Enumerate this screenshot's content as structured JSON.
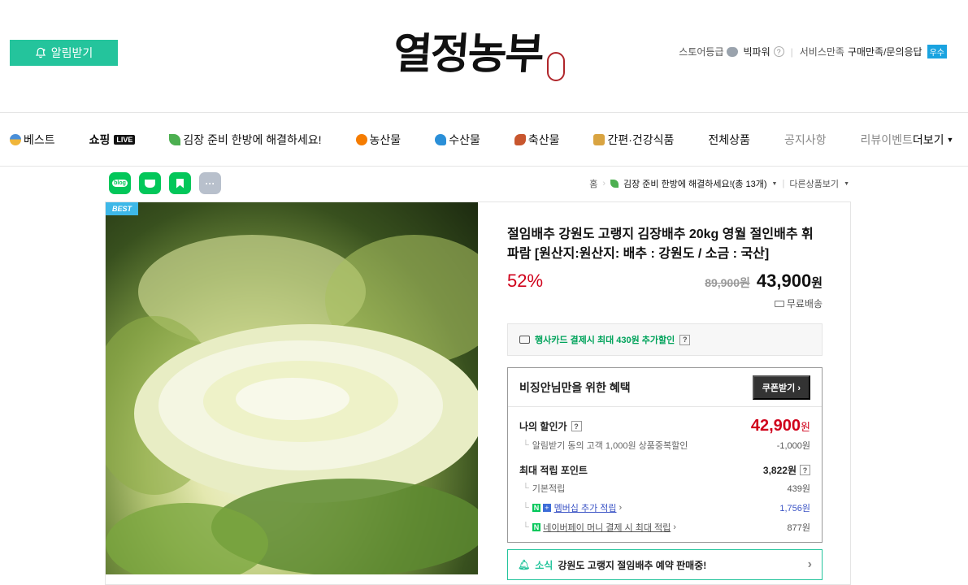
{
  "header": {
    "alarm_button": "알림받기",
    "logo_text": "열정농부",
    "store_grade_label": "스토어등급",
    "store_grade_value": "빅파워",
    "service_label": "서비스만족",
    "service_value": "구매만족/문의응답",
    "service_badge": "우수"
  },
  "nav": {
    "items": [
      {
        "label": "베스트",
        "icon": "medal-icon"
      },
      {
        "label": "쇼핑",
        "badge": "LIVE"
      },
      {
        "label": "김장 준비 한방에 해결하세요!",
        "icon": "leaf-icon"
      },
      {
        "label": "농산물",
        "icon": "orange-icon"
      },
      {
        "label": "수산물",
        "icon": "wave-icon"
      },
      {
        "label": "축산물",
        "icon": "meat-icon"
      },
      {
        "label": "간편·건강식품",
        "icon": "food-icon"
      },
      {
        "label": "전체상품"
      },
      {
        "label": "공지사항"
      },
      {
        "label": "리뷰이벤트"
      }
    ],
    "more": "더보기"
  },
  "share": {
    "blog": "blog",
    "cafe_icon": "cup-icon",
    "bookmark_icon": "bookmark-icon",
    "more": "···"
  },
  "breadcrumb": {
    "home": "홈",
    "category": "김장 준비 한방에 해결하세요!(총 13개)",
    "other": "다른상품보기"
  },
  "product": {
    "best_tag": "BEST",
    "title": "절임배추 강원도 고랭지 김장배추 20kg 영월 절인배추 휘파람 [원산지:원산지: 배추 : 강원도 / 소금 : 국산]",
    "discount": "52%",
    "original_price": "89,900원",
    "final_price": "43,900",
    "final_unit": "원",
    "shipping": "무료배송",
    "card_promo": "행사카드 결제시 최대 430원 추가할인",
    "benefit_title": "비징안님만을 위한 혜택",
    "coupon_button": "쿠폰받기",
    "my_discount_label": "나의 할인가",
    "my_discount_price": "42,900",
    "my_discount_unit": "원",
    "my_discount_note": "알림받기 동의 고객 1,000원 상품중복할인",
    "my_discount_amount": "-1,000원",
    "max_point_label": "최대 적립 포인트",
    "max_point_value": "3,822원",
    "base_point_label": "기본적립",
    "base_point_value": "439원",
    "membership_label": "멤버십 추가 적립",
    "membership_value": "1,756원",
    "npay_label": "네이버페이 머니 결제 시 최대 적립",
    "npay_value": "877원",
    "news_tag": "소식",
    "news_text": "강원도 고랭지 절임배추 예약 판매중!"
  },
  "colors": {
    "accent": "#24c49c",
    "price_red": "#d0021b",
    "link_blue": "#3a53c5",
    "naver_green": "#03c75a"
  }
}
